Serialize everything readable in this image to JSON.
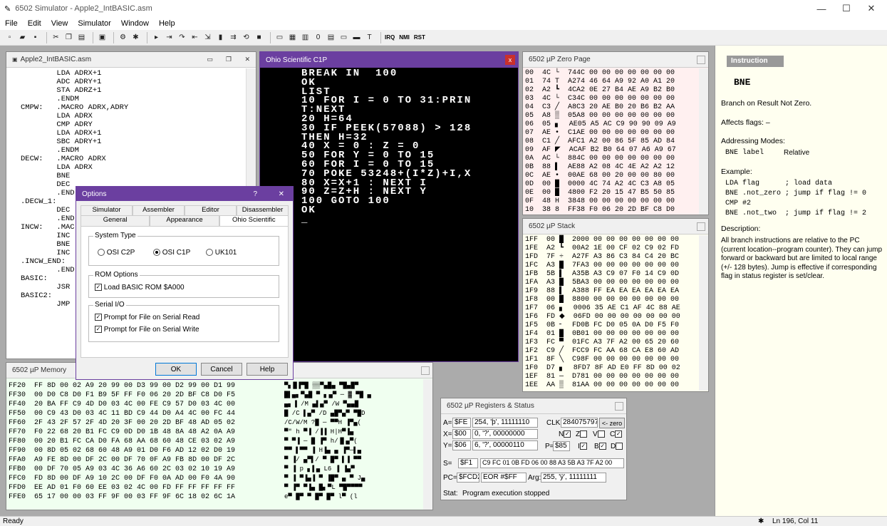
{
  "app": {
    "title": "6502 Simulator - Apple2_IntBASIC.asm",
    "status": "Ready",
    "position": "Ln 196, Col 11"
  },
  "menu": [
    "File",
    "Edit",
    "View",
    "Simulator",
    "Window",
    "Help"
  ],
  "toolbar": {
    "irq": "IRQ",
    "nmi": "NMI",
    "rst": "RST"
  },
  "source": {
    "title": "Apple2_IntBASIC.asm",
    "lines": [
      "        LDA ADRX+1",
      "        ADC ADRY+1",
      "        STA ADRZ+1",
      "        .ENDM",
      "",
      "CMPW:   .MACRO ADRX,ADRY",
      "        LDA ADRX",
      "        CMP ADRY",
      "        LDA ADRX+1",
      "        SBC ADRY+1",
      "        .ENDM",
      "",
      "DECW:   .MACRO ADRX",
      "        LDA ADRX",
      "        BNE",
      "        DEC",
      "        .END",
      ".DECW_1:",
      "        DEC",
      "        .END",
      "",
      "INCW:   .MAC",
      "        INC",
      "        BNE",
      "        INC",
      ".INCW_END:",
      "        .END",
      "",
      "",
      "BASIC:",
      "        JSR",
      "BASIC2:",
      "        JMP"
    ]
  },
  "terminal": {
    "title": "Ohio Scientific C1P",
    "lines": [
      "",
      "",
      "",
      "",
      "",
      "",
      "",
      "",
      "BREAK IN  100",
      "OK",
      "LIST",
      "",
      "10 FOR I = 0 TO 31:PRIN",
      "T:NEXT",
      "20 H=64",
      "30 IF PEEK(57088) > 128",
      "THEN H=32",
      "40 X = 0 : Z = 0",
      "50 FOR Y = 0 TO 15",
      "60 FOR I = 0 TO 15",
      "70 POKE 53248+(I*Z)+I,X",
      "",
      "80 X=X+1 : NEXT I",
      "90 Z=Z+H : NEXT Y",
      "100 GOTO 100",
      "OK",
      "_"
    ]
  },
  "zeropage": {
    "title": "6502 µP Zero Page",
    "lines": [
      "00  4C └  744C 00 00 00 00 00 00 00",
      "01  74 T  A274 46 64 A9 92 A0 A1 20",
      "02  A2 ┗  4CA2 0E 27 B4 AE A9 B2 B0",
      "03  4C └  C34C 00 00 00 00 00 00 00",
      "04  C3 ╱  A8C3 20 AE B0 20 B6 B2 AA",
      "05  A8 ▒  05A8 00 00 00 00 00 00 00",
      "06  05 ▖  AE05 A5 AC C9 90 90 09 A9",
      "07  AE •  C1AE 00 00 00 00 00 00 00",
      "08  C1 ╱  AFC1 A2 00 86 5F 85 AD 84",
      "09  AF ◤  ACAF B2 B0 64 07 A6 A9 67",
      "0A  AC └  884C 00 00 00 00 00 00 00",
      "0B  88 ▌  AE88 A2 08 4C 4E A2 A2 12",
      "0C  AE •  00AE 68 00 20 00 00 80 00",
      "0D  00 █  0000 4C 74 A2 4C C3 A8 05",
      "0E  00 █  4800 F2 20 15 47 B5 50 85",
      "0F  48 H  3848 00 00 00 00 00 00 00",
      "10  38 8  FF38 F0 06 20 2D BF C8 D0"
    ]
  },
  "stack": {
    "title": "6502 µP Stack",
    "lines": [
      "1FF  00 █  2000 00 00 00 00 00 00 00",
      "1FE  A2 ┗  00A2 1E 00 CF 02 C9 02 FD",
      "1FD  7F ÷  A27F A3 86 C3 84 C4 20 BC",
      "1FC  A3 █  7FA3 00 00 00 00 00 00 00",
      "1FB  5B ▌  A35B A3 C9 07 F0 14 C9 0D",
      "1FA  A3 █  5BA3 00 00 00 00 00 00 00",
      "1F9  88 ▌  A388 FF EA EA EA EA EA EA",
      "1F8  00 █  8800 00 00 00 00 00 00 00",
      "1F7  06 ▖  0006 35 AE C1 AF 4C 88 AE",
      "1F6  FD ◆  06FD 00 00 00 00 00 00 00",
      "1F5  0B ╴  FD0B FC D0 05 0A D0 F5 F0",
      "1F4  01 █  0B01 00 00 00 00 00 00 00",
      "1F3  FC ▀  01FC A3 7F A2 00 65 20 60",
      "1F2  C9 ╱  FCC9 FC AA 68 CA E8 60 AD",
      "1F1  8F ╲  C98F 00 00 00 00 00 00 00",
      "1F0  D7 ▖  8FD7 8F AD E0 FF 8D 00 02",
      "1EF  81 —  D781 00 00 00 00 00 00 00",
      "1EE  AA ▒  81AA 00 00 00 00 00 00 00"
    ]
  },
  "memory": {
    "title": "6502 µP Memory",
    "lines": [
      "FF20  FF 8D 00 02 A9 20 99 00 D3 99 00 D2 99 00 D1 99",
      "FF30  00 D0 C8 D0 F1 B9 5F FF F0 06 20 2D BF C8 D0 F5",
      "FF40  20 BA FF C9 4D D0 03 4C 00 FE C9 57 D0 03 4C 00",
      "FF50  00 C9 43 D0 03 4C 11 BD C9 44 D0 A4 4C 00 FC 44",
      "FF60  2F 43 2F 57 2F 4D 20 3F 00 20 2D BF 48 AD 05 02",
      "FF70  F0 22 68 20 B1 FC C9 0D D0 1B 48 8A 48 A2 0A A9",
      "FF80  00 20 B1 FC CA D0 FA 68 AA 68 60 48 CE 03 02 A9",
      "FF90  00 8D 05 02 68 60 48 A9 01 D0 F6 AD 12 02 D0 19",
      "FFA0  A9 FE 8D 00 DF 2C 00 DF 70 0F A9 FB 8D 00 DF 2C",
      "FFB0  00 DF 70 05 A9 03 4C 36 A6 60 2C 03 02 10 19 A9",
      "FFC0  FD 8D 00 DF A9 10 2C 00 DF F0 0A AD 00 F0 4A 90",
      "FFD0  EE AD 01 F0 60 EE 03 02 4C 00 FD FF FF FF FF FF",
      "FFE0  65 17 00 00 03 FF 9F 00 03 FF 9F 6C 18 02 6C 1A"
    ],
    "ascii": [
      "▀▖█▐▀█ ▒▒▀▄█▄ ▀█▄█▀",
      "█▌▄▖▀▄█ ▀ ▖▄▀ ─ ▓ ▀█ ▄",
      "▄▖▐ /M ▄▌▄▀ /W ▀▄▄█",
      "█ /C ▌▄▀ /D ▄█▀▄▀ ▀█D",
      "/C/W/M ?█ ─ ▀▀H ▐▀▄(",
      "▀\" h ▀▐ /▐▐ H|H▀▐▄",
      "▀ ▀▐ ─ █ ▐▀ h/▐▌▄▀(",
      "▀▀ ▌▀▀ ▐ H▐▄ ▄ ▐▀─▌▄",
      "▀ ▐/ ▄▀▌/ ▀ █▀ ▌▐ ▀▀",
      "▀ ▐ p ▖▌▄ L6 ▐ ▐▄▀",
      "▀ ▐ ▀▐▄▐ ▀ ▐█▀ ▄ ▀ J▄",
      "▀ ▐▀ ▀▐▄ █▖▀L ▀█▀▀▀▀",
      "e▀ █▀ ▀ █▀ █▀ l▀ (l"
    ]
  },
  "registers": {
    "title": "6502 µP Registers & Status",
    "a_label": "A=",
    "a": "$FE",
    "a_info": "254, 'þ', 11111110",
    "x_label": "X=",
    "x": "$00",
    "x_info": "0,   '?', 00000000",
    "y_label": "Y=",
    "y": "$06",
    "y_info": "6,   '?', 00000110",
    "clk_label": "CLK:",
    "clk": "284075797",
    "zero_btn": "<- zero",
    "p_label": "P=",
    "p": "$85",
    "s_label": "S=",
    "s": "$F1",
    "s_bytes": "C9 FC 01 0B FD 06 00 88 A3 5B A3 7F A2 00",
    "pc_label": "PC=",
    "pc": "$FCD2",
    "instr": "EOR #$FF",
    "arg_label": "Arg:",
    "arg": "255, 'ÿ', 11111111",
    "stat_label": "Stat:",
    "stat": "Program execution stopped",
    "flags": [
      {
        "n": "N",
        "v": true
      },
      {
        "n": "Z",
        "v": false
      },
      {
        "n": "V",
        "v": false
      },
      {
        "n": "C",
        "v": true
      },
      {
        "n": "I",
        "v": true
      },
      {
        "n": "B",
        "v": true
      },
      {
        "n": "D",
        "v": false
      }
    ]
  },
  "options": {
    "title": "Options",
    "help_btn": "?",
    "tabs_row1": [
      "Simulator",
      "Assembler",
      "Editor",
      "Disassembler"
    ],
    "tabs_row2": [
      "General",
      "Appearance",
      "Ohio Scientific"
    ],
    "system_type": "System Type",
    "sys_opts": [
      "OSI C2P",
      "OSI C1P",
      "UK101"
    ],
    "rom_options": "ROM Options",
    "rom_check": "Load BASIC ROM $A000",
    "serial": "Serial I/O",
    "serial_read": "Prompt for File on Serial Read",
    "serial_write": "Prompt for File on Serial Write",
    "ok": "OK",
    "cancel": "Cancel",
    "help": "Help"
  },
  "instruction": {
    "tab": "Instruction",
    "mnemonic": "BNE",
    "summary": "Branch on Result Not Zero.",
    "flags": "Affects flags: –",
    "modes_title": "Addressing Modes:",
    "mode_code": "BNE label",
    "mode_name": "Relative",
    "example_title": "Example:",
    "example": [
      "LDA flag      ; load data",
      "BNE .not_zero ; jump if flag != 0",
      "CMP #2",
      "BNE .not_two  ; jump if flag != 2"
    ],
    "desc_title": "Description:",
    "desc": "All branch instructions are relative to the PC (current location--program counter). They can jump forward or backward but are limited to local range (+/- 128 bytes). Jump is effective if corresponding flag in status register is set/clear."
  }
}
